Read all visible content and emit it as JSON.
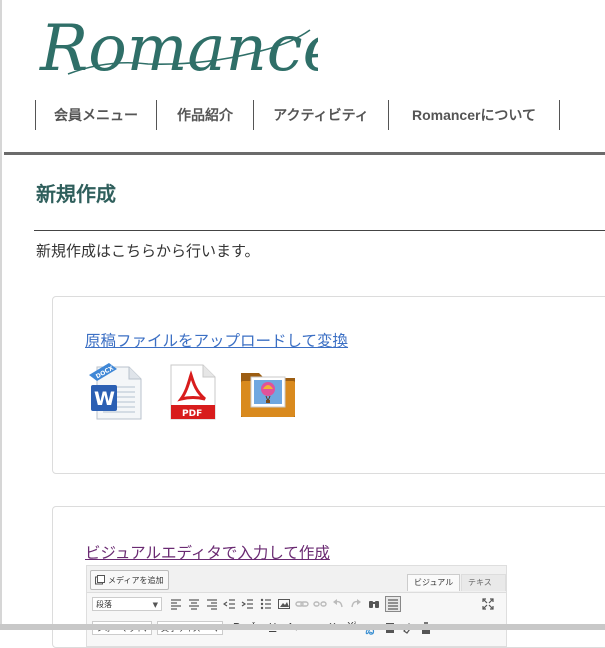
{
  "brand": {
    "logo_text": "Romancer",
    "color": "#2f6f68"
  },
  "nav": {
    "items": [
      "会員メニュー",
      "作品紹介",
      "アクティビティ",
      "Romancerについて"
    ]
  },
  "page": {
    "title": "新規作成",
    "intro": "新規作成はこちらから行います。"
  },
  "upload_card": {
    "link_text": "原稿ファイルをアップロードして変換",
    "icons": [
      "word-docx-icon",
      "pdf-icon",
      "image-folder-icon"
    ],
    "docx_badge": "DOCX",
    "pdf_badge": "PDF"
  },
  "editor_card": {
    "link_text": "ビジュアルエディタで入力して作成",
    "add_media_label": "メディアを追加",
    "tabs": {
      "visual": "ビジュアル",
      "text": "テキスト"
    },
    "paragraph_select": "段落",
    "format_select": "フォーマット",
    "font_size_select": "文字サイズ"
  },
  "colors": {
    "link": "#3b6fc4",
    "visited_link": "#6a2a72",
    "heading": "#2f5f5c"
  }
}
